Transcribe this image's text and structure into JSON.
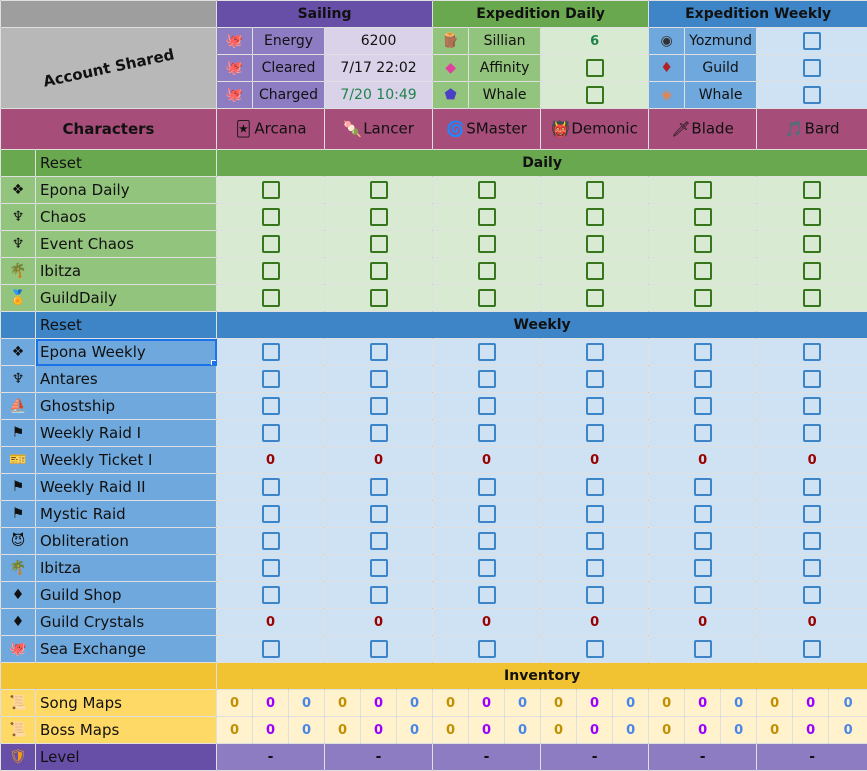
{
  "header": {
    "account_shared": "Account Shared",
    "sailing": {
      "title": "Sailing",
      "rows": [
        {
          "icon": "sea-creature-icon",
          "label": "Energy",
          "value": "6200",
          "color": "#111111"
        },
        {
          "icon": "sea-creature-icon",
          "label": "Cleared",
          "value": "7/17 22:02",
          "color": "#111111"
        },
        {
          "icon": "sea-creature-icon",
          "label": "Charged",
          "value": "7/20 10:49",
          "color": "#1e8449"
        }
      ]
    },
    "expedition_daily": {
      "title": "Expedition Daily",
      "rows": [
        {
          "icon": "sillian-icon",
          "label": "Sillian",
          "value": "6"
        },
        {
          "icon": "affinity-gem-icon",
          "label": "Affinity",
          "value": ""
        },
        {
          "icon": "whale-gem-icon",
          "label": "Whale",
          "value": ""
        }
      ]
    },
    "expedition_weekly": {
      "title": "Expedition Weekly",
      "rows": [
        {
          "icon": "yozmund-orb-icon",
          "label": "Yozmund"
        },
        {
          "icon": "guild-crystal-icon",
          "label": "Guild"
        },
        {
          "icon": "whale-diamond-icon",
          "label": "Whale"
        }
      ]
    }
  },
  "characters": {
    "label": "Characters",
    "list": [
      {
        "name": "Arcana",
        "icon": "card-icon",
        "glyph": "🃏"
      },
      {
        "name": "Lancer",
        "icon": "lance-icon",
        "glyph": "🍡"
      },
      {
        "name": "SMaster",
        "icon": "spiral-icon",
        "glyph": "🌀"
      },
      {
        "name": "Demonic",
        "icon": "demon-mask-icon",
        "glyph": "👹"
      },
      {
        "name": "Blade",
        "icon": "sword-icon",
        "glyph": "🗡"
      },
      {
        "name": "Bard",
        "icon": "music-note-icon",
        "glyph": "🎵"
      }
    ]
  },
  "daily": {
    "reset_label": "Reset",
    "title": "Daily",
    "rows": [
      {
        "name": "Epona Daily",
        "icon": "epona-emblem-icon",
        "glyph": "❖",
        "type": "check"
      },
      {
        "name": "Chaos",
        "icon": "chaos-trophy-icon",
        "glyph": "♆",
        "type": "check"
      },
      {
        "name": "Event Chaos",
        "icon": "chaos-trophy-icon",
        "glyph": "♆",
        "type": "check"
      },
      {
        "name": "Ibitza",
        "icon": "palm-tree-icon",
        "glyph": "🌴",
        "type": "check"
      },
      {
        "name": "GuildDaily",
        "icon": "medal-icon",
        "glyph": "🏅",
        "type": "check"
      }
    ]
  },
  "weekly": {
    "reset_label": "Reset",
    "title": "Weekly",
    "rows": [
      {
        "name": "Epona Weekly",
        "icon": "epona-emblem-icon",
        "glyph": "❖",
        "type": "check",
        "selected": true
      },
      {
        "name": "Antares",
        "icon": "antares-statue-icon",
        "glyph": "♆",
        "type": "check"
      },
      {
        "name": "Ghostship",
        "icon": "ghost-ship-icon",
        "glyph": "⛵",
        "type": "check"
      },
      {
        "name": "Weekly Raid I",
        "icon": "red-banner-icon",
        "glyph": "⚑",
        "type": "check"
      },
      {
        "name": "Weekly Ticket I",
        "icon": "ticket-icon",
        "glyph": "🎫",
        "type": "count",
        "values": [
          "0",
          "0",
          "0",
          "0",
          "0",
          "0"
        ]
      },
      {
        "name": "Weekly Raid II",
        "icon": "red-banner-icon",
        "glyph": "⚑",
        "type": "check"
      },
      {
        "name": "Mystic Raid",
        "icon": "blue-banner-icon",
        "glyph": "⚑",
        "type": "check"
      },
      {
        "name": "Obliteration",
        "icon": "demon-head-icon",
        "glyph": "😈",
        "type": "check"
      },
      {
        "name": "Ibitza",
        "icon": "palm-tree-icon",
        "glyph": "🌴",
        "type": "check"
      },
      {
        "name": "Guild Shop",
        "icon": "guild-crystal-icon",
        "glyph": "♦",
        "type": "check"
      },
      {
        "name": "Guild Crystals",
        "icon": "guild-crystal-icon",
        "glyph": "♦",
        "type": "count",
        "values": [
          "0",
          "0",
          "0",
          "0",
          "0",
          "0"
        ]
      },
      {
        "name": "Sea Exchange",
        "icon": "sea-creature-icon",
        "glyph": "🐙",
        "type": "check"
      }
    ]
  },
  "inventory": {
    "title": "Inventory",
    "rows": [
      {
        "name": "Song Maps",
        "icon": "scroll-map-icon",
        "glyph": "📜",
        "values": [
          "0",
          "0",
          "0",
          "0",
          "0",
          "0",
          "0",
          "0",
          "0",
          "0",
          "0",
          "0",
          "0",
          "0",
          "0",
          "0",
          "0",
          "0"
        ]
      },
      {
        "name": "Boss Maps",
        "icon": "scroll-map-icon",
        "glyph": "📜",
        "values": [
          "0",
          "0",
          "0",
          "0",
          "0",
          "0",
          "0",
          "0",
          "0",
          "0",
          "0",
          "0",
          "0",
          "0",
          "0",
          "0",
          "0",
          "0"
        ]
      }
    ],
    "colors": [
      "#bf9000",
      "#9900ff",
      "#4a86e8"
    ]
  },
  "level": {
    "name": "Level",
    "icon": "level-crest-icon",
    "glyph": "🛡",
    "values": [
      "-",
      "-",
      "-",
      "-",
      "-",
      "-"
    ]
  }
}
